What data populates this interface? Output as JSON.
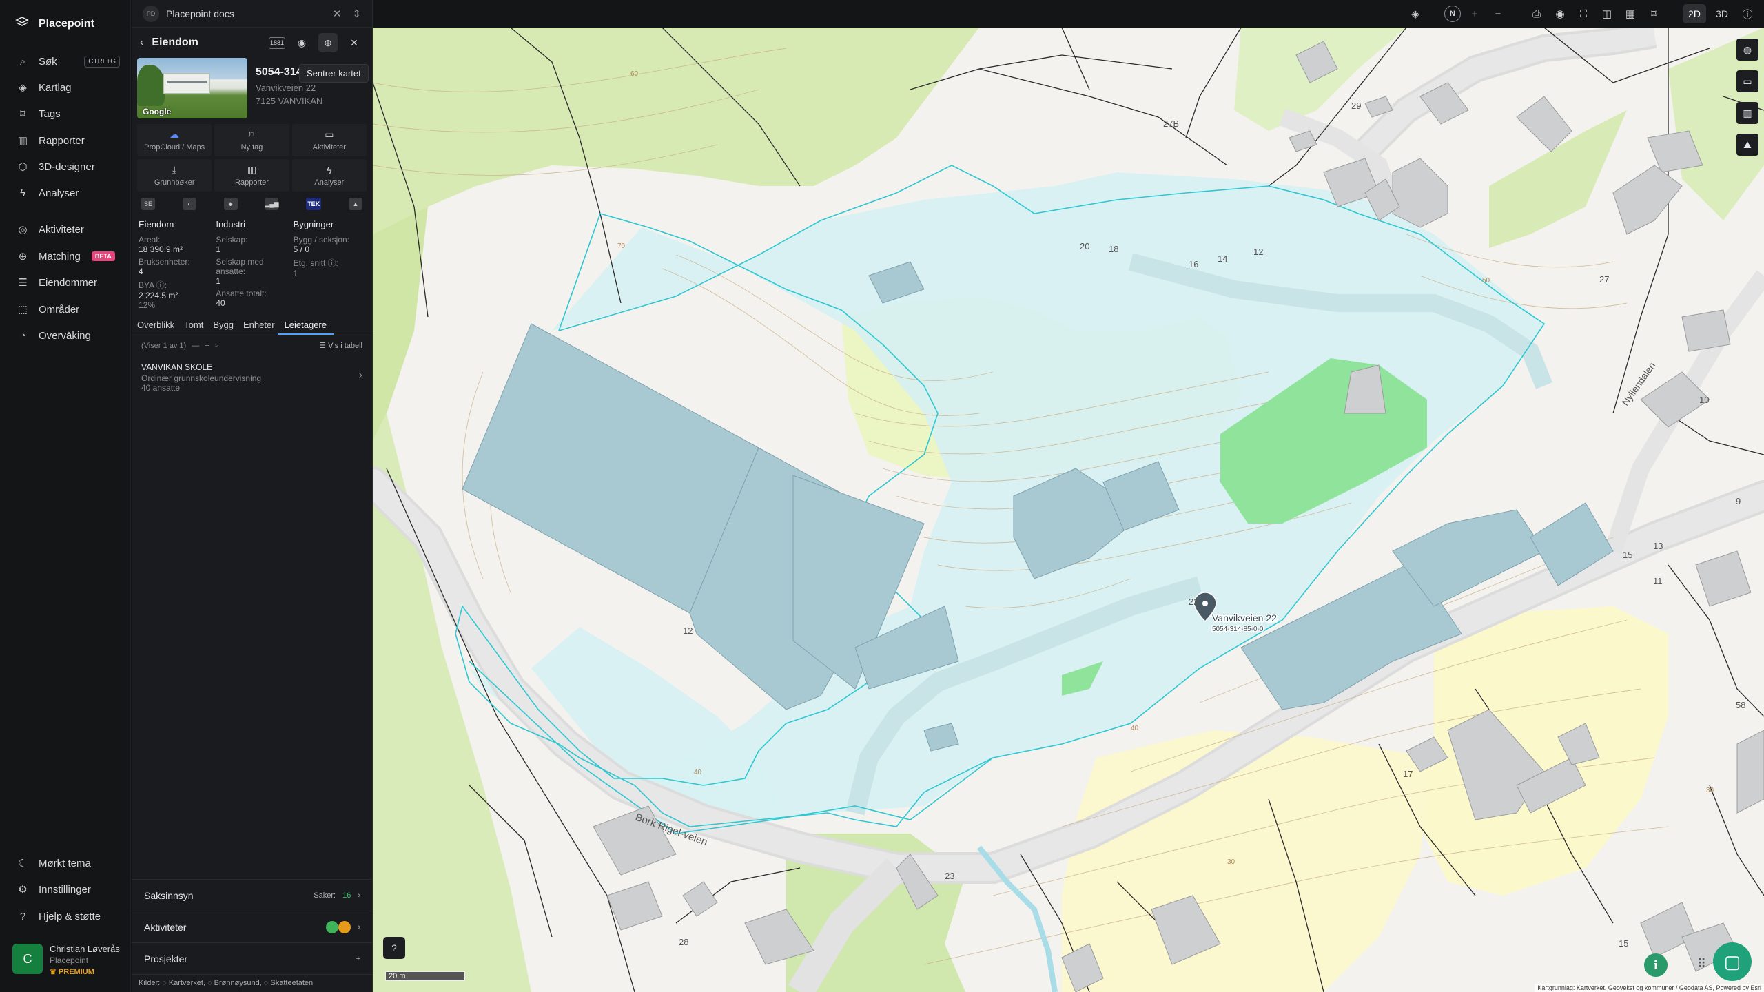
{
  "app": {
    "name": "Placepoint"
  },
  "nav": {
    "search": {
      "label": "Søk",
      "shortcut": "CTRL+G"
    },
    "items": [
      {
        "label": "Kartlag",
        "icon": "layers-icon"
      },
      {
        "label": "Tags",
        "icon": "bookmark-icon"
      },
      {
        "label": "Rapporter",
        "icon": "chart-icon"
      },
      {
        "label": "3D-designer",
        "icon": "cube-icon"
      },
      {
        "label": "Analyser",
        "icon": "bolt-icon"
      }
    ],
    "items2": [
      {
        "label": "Aktiviteter",
        "icon": "activity-icon"
      },
      {
        "label": "Matching",
        "badge": "BETA",
        "icon": "matching-icon"
      },
      {
        "label": "Eiendommer",
        "icon": "list-icon"
      },
      {
        "label": "Områder",
        "icon": "area-icon"
      },
      {
        "label": "Overvåking",
        "icon": "monitor-icon"
      }
    ],
    "footer": [
      {
        "label": "Mørkt tema",
        "icon": "moon-icon"
      },
      {
        "label": "Innstillinger",
        "icon": "gear-icon"
      },
      {
        "label": "Hjelp & støtte",
        "icon": "help-icon"
      }
    ],
    "user": {
      "initial": "C",
      "name": "Christian Løverås",
      "org": "Placepoint",
      "plan": "PREMIUM"
    }
  },
  "panel": {
    "doc": {
      "badge": "PD",
      "title": "Placepoint docs"
    },
    "header": {
      "title": "Eiendom",
      "badge": "1881",
      "tooltip": "Sentrer kartet"
    },
    "property": {
      "id": "5054-314-85-0-0",
      "address": "Vanvikveien 22",
      "zip": "7125 VANVIKAN",
      "photo_label": "Google"
    },
    "actions": [
      {
        "label": "PropCloud / Maps",
        "icon": "cloud-icon"
      },
      {
        "label": "Ny tag",
        "icon": "bookmark-icon"
      },
      {
        "label": "Aktiviteter",
        "icon": "chat-icon"
      },
      {
        "label": "Grunnbøker",
        "icon": "download-icon"
      },
      {
        "label": "Rapporter",
        "icon": "chart-icon"
      },
      {
        "label": "Analyser",
        "icon": "bolt-icon"
      }
    ],
    "sources": [
      "SE",
      "◐",
      "♣",
      "▂▄▆",
      "TEK",
      "▲"
    ],
    "stats": {
      "eiendom": {
        "title": "Eiendom",
        "areal_label": "Areal:",
        "areal": "18 390.9 m²",
        "bruks_label": "Bruksenheter:",
        "bruks": "4",
        "bya_label": "BYA ⓘ:",
        "bya": "2 224.5 m²",
        "bya_pct": "12%"
      },
      "industri": {
        "title": "Industri",
        "selskap_label": "Selskap:",
        "selskap": "1",
        "ansatte_label": "Selskap med ansatte:",
        "ansatte": "1",
        "totalt_label": "Ansatte totalt:",
        "totalt": "40"
      },
      "bygninger": {
        "title": "Bygninger",
        "bygg_label": "Bygg / seksjon:",
        "bygg": "5 / 0",
        "etg_label": "Etg. snitt ⓘ:",
        "etg": "1"
      }
    },
    "tabs": [
      "Overblikk",
      "Tomt",
      "Bygg",
      "Enheter",
      "Leietagere"
    ],
    "active_tab": "Leietagere",
    "list": {
      "count": "(Viser 1 av 1)",
      "view": "Vis i tabell"
    },
    "tenant": {
      "name": "VANVIKAN SKOLE",
      "type": "Ordinær grunnskoleundervisning",
      "employees": "40 ansatte"
    },
    "bottom": {
      "saksinnsyn": {
        "label": "Saksinnsyn",
        "cases_label": "Saker:",
        "cases": "16"
      },
      "aktiviteter": {
        "label": "Aktiviteter"
      },
      "prosjekter": {
        "label": "Prosjekter"
      },
      "kilder": "Kilder: ◌ Kartverket, ◌ Brønnøysund, ◌ Skatteetaten"
    }
  },
  "topbar": {
    "compass": "N",
    "mode_2d": "2D",
    "mode_3d": "3D",
    "active_mode": "2D"
  },
  "map": {
    "marker_label": "Vanvikveien 22",
    "marker_sub": "5054-314-85-0-0",
    "road_label": "Bork Rigel-veien",
    "road_label2": "Nyllendalen",
    "house_numbers": [
      "29",
      "27B",
      "20",
      "18",
      "16",
      "14",
      "12",
      "27",
      "10",
      "12",
      "22",
      "15",
      "13",
      "11",
      "9",
      "17",
      "23",
      "28",
      "58",
      "15"
    ],
    "contours": [
      "60",
      "70",
      "50",
      "40",
      "40",
      "30",
      "30"
    ],
    "scale": "20 m",
    "attribution": "Kartgrunnlag: Kartverket, Geovekst og kommuner / Geodata AS, Powered by Esri"
  }
}
